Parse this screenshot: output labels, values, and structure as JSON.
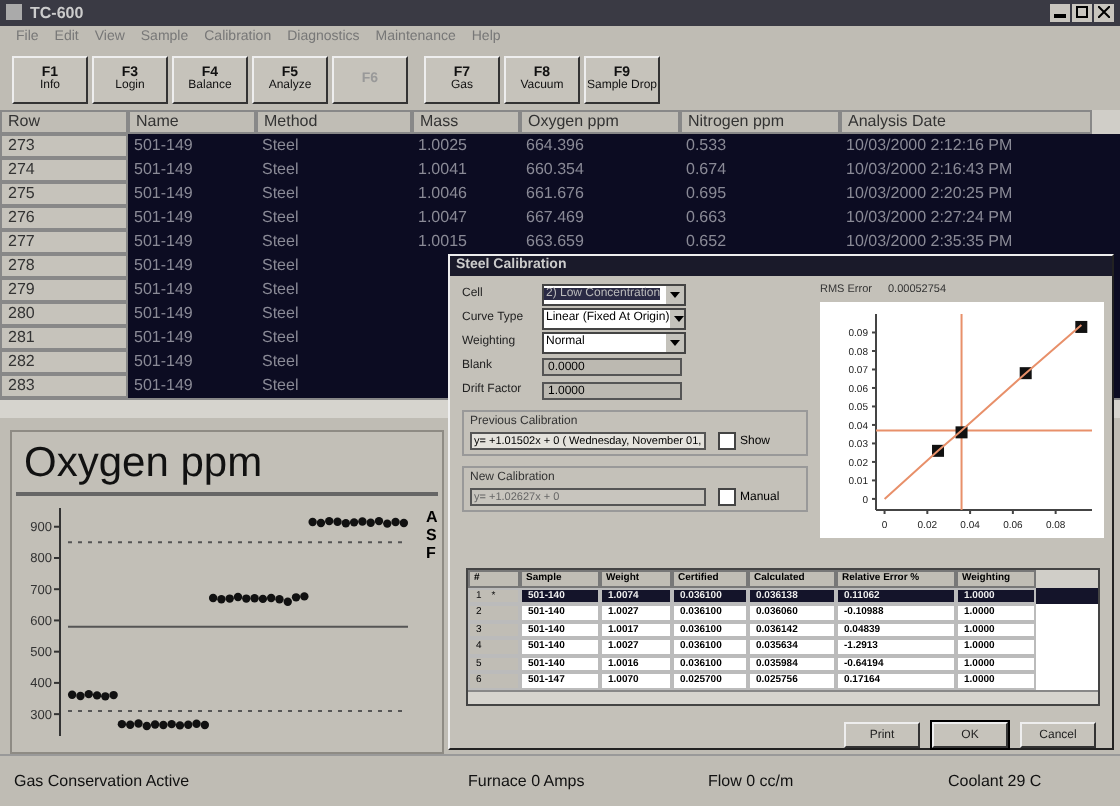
{
  "window": {
    "title": "TC-600"
  },
  "menu": [
    "File",
    "Edit",
    "View",
    "Sample",
    "Calibration",
    "Diagnostics",
    "Maintenance",
    "Help"
  ],
  "toolbar": [
    {
      "key": "F1",
      "label": "Info",
      "disabled": false
    },
    {
      "key": "F3",
      "label": "Login",
      "disabled": false
    },
    {
      "key": "F4",
      "label": "Balance",
      "disabled": false
    },
    {
      "key": "F5",
      "label": "Analyze",
      "disabled": false
    },
    {
      "key": "F6",
      "disabled": true
    },
    {
      "key": "F7",
      "label": "Gas",
      "disabled": false
    },
    {
      "key": "F8",
      "label": "Vacuum",
      "disabled": false
    },
    {
      "key": "F9",
      "label": "Sample Drop",
      "disabled": false
    }
  ],
  "table": {
    "columns": [
      "Row",
      "Name",
      "Method",
      "Mass",
      "Oxygen ppm",
      "Nitrogen ppm",
      "Analysis Date"
    ],
    "rows": [
      {
        "cells": [
          "273",
          "501-149",
          "Steel",
          "1.0025",
          "664.396",
          "0.533",
          "10/03/2000 2:12:16 PM"
        ]
      },
      {
        "cells": [
          "274",
          "501-149",
          "Steel",
          "1.0041",
          "660.354",
          "0.674",
          "10/03/2000 2:16:43 PM"
        ]
      },
      {
        "cells": [
          "275",
          "501-149",
          "Steel",
          "1.0046",
          "661.676",
          "0.695",
          "10/03/2000 2:20:25 PM"
        ]
      },
      {
        "cells": [
          "276",
          "501-149",
          "Steel",
          "1.0047",
          "667.469",
          "0.663",
          "10/03/2000 2:27:24 PM"
        ]
      },
      {
        "cells": [
          "277",
          "501-149",
          "Steel",
          "1.0015",
          "663.659",
          "0.652",
          "10/03/2000 2:35:35 PM"
        ]
      },
      {
        "cells": [
          "278",
          "501-149",
          "Steel"
        ]
      },
      {
        "cells": [
          "279",
          "501-149",
          "Steel"
        ]
      },
      {
        "cells": [
          "280",
          "501-149",
          "Steel"
        ]
      },
      {
        "cells": [
          "281",
          "501-149",
          "Steel"
        ]
      },
      {
        "cells": [
          "282",
          "501-149",
          "Steel"
        ]
      },
      {
        "cells": [
          "283",
          "501-149",
          "Steel"
        ]
      }
    ]
  },
  "oxygen_panel": {
    "title": "Oxygen ppm",
    "side_labels": [
      "A",
      "S",
      "F"
    ],
    "chart_data": {
      "type": "scatter",
      "ylim": [
        230,
        960
      ],
      "yticks": [
        300,
        400,
        500,
        600,
        700,
        800,
        900
      ],
      "categories": [
        null,
        null,
        null,
        null,
        null,
        null,
        null,
        null,
        null,
        null,
        null,
        null,
        null,
        null,
        null,
        null,
        null,
        null,
        null,
        null,
        null,
        null,
        null,
        null,
        null,
        null,
        null,
        null,
        null,
        null,
        null,
        null,
        null,
        null,
        null,
        null,
        null,
        null,
        null,
        null,
        null
      ],
      "series": [
        {
          "color": "#111111",
          "values": [
            362,
            358,
            364,
            360,
            357,
            361,
            268,
            266,
            270,
            262,
            267,
            265,
            268,
            264,
            266,
            269,
            265,
            672,
            668,
            670,
            675,
            670,
            671,
            669,
            672,
            668,
            660,
            674,
            677,
            915,
            912,
            918,
            916,
            911,
            914,
            917,
            913,
            918,
            910,
            915,
            912
          ]
        }
      ],
      "ref_lines": [
        {
          "axis": "y",
          "value": 850
        },
        {
          "axis": "y",
          "value": 580
        },
        {
          "axis": "y",
          "value": 310
        }
      ]
    }
  },
  "calibration_dialog": {
    "title": "Steel Calibration",
    "fields": [
      {
        "label": "Cell",
        "kind": "dropdown",
        "value": "2) Low Concentration",
        "focused": true
      },
      {
        "label": "Curve Type",
        "kind": "dropdown",
        "value": "Linear (Fixed At Origin)",
        "focused": false
      },
      {
        "label": "Weighting",
        "kind": "dropdown",
        "value": "Normal",
        "focused": false
      },
      {
        "label": "Blank",
        "kind": "readonly",
        "value": "0.0000"
      },
      {
        "label": "Drift Factor",
        "kind": "readonly",
        "value": "1.0000"
      }
    ],
    "previous": {
      "label": "Previous Calibration",
      "value": "y= +1.01502x + 0 ( Wednesday, November 01,",
      "check_label": "Show",
      "checked": false,
      "disabled": false
    },
    "new": {
      "label": "New Calibration",
      "value": "y= +1.02627x + 0",
      "check_label": "Manual",
      "checked": false,
      "disabled": true
    },
    "rms": {
      "label": "RMS Error",
      "value": "0.00052754"
    },
    "chart_data": {
      "type": "scatter",
      "x": [
        0,
        0.025,
        0.036,
        0.066,
        0.092
      ],
      "xlim": [
        -0.004,
        0.097
      ],
      "ylim": [
        -0.006,
        0.1
      ],
      "xticks": [
        0,
        0.02,
        0.04,
        0.06,
        0.08
      ],
      "yticks": [
        0,
        0.01,
        0.02,
        0.03,
        0.04,
        0.05,
        0.06,
        0.07,
        0.08,
        0.09
      ],
      "series": [
        {
          "color": "#111111",
          "values": [
            null,
            0.026,
            0.036,
            0.068,
            0.093
          ]
        },
        {
          "type": "line",
          "color": "#e8906a",
          "values": [
            0,
            0.026,
            0.037,
            0.068,
            0.094
          ]
        }
      ],
      "ref_lines": [
        {
          "axis": "x",
          "value": 0.036
        },
        {
          "axis": "y",
          "value": 0.037
        }
      ]
    },
    "grid": {
      "columns": [
        "#",
        "Sample",
        "Weight",
        "Certified",
        "Calculated",
        "Relative Error %",
        "Weighting"
      ],
      "rows": [
        {
          "selected": true,
          "marker": "*",
          "cells": [
            "1",
            "501-140",
            "1.0074",
            "0.036100",
            "0.036138",
            "0.11062",
            "1.0000"
          ]
        },
        {
          "selected": false,
          "cells": [
            "2",
            "501-140",
            "1.0027",
            "0.036100",
            "0.036060",
            "-0.10988",
            "1.0000"
          ]
        },
        {
          "selected": false,
          "cells": [
            "3",
            "501-140",
            "1.0017",
            "0.036100",
            "0.036142",
            "0.04839",
            "1.0000"
          ]
        },
        {
          "selected": false,
          "cells": [
            "4",
            "501-140",
            "1.0027",
            "0.036100",
            "0.035634",
            "-1.2913",
            "1.0000"
          ]
        },
        {
          "selected": false,
          "cells": [
            "5",
            "501-140",
            "1.0016",
            "0.036100",
            "0.035984",
            "-0.64194",
            "1.0000"
          ]
        },
        {
          "selected": false,
          "cells": [
            "6",
            "501-147",
            "1.0070",
            "0.025700",
            "0.025756",
            "0.17164",
            "1.0000"
          ]
        }
      ]
    },
    "buttons": [
      "Print",
      "OK",
      "Cancel"
    ]
  },
  "status_bar": [
    "Gas Conservation Active",
    "Furnace 0 Amps",
    "Flow 0 cc/m",
    "Coolant 29 C"
  ]
}
